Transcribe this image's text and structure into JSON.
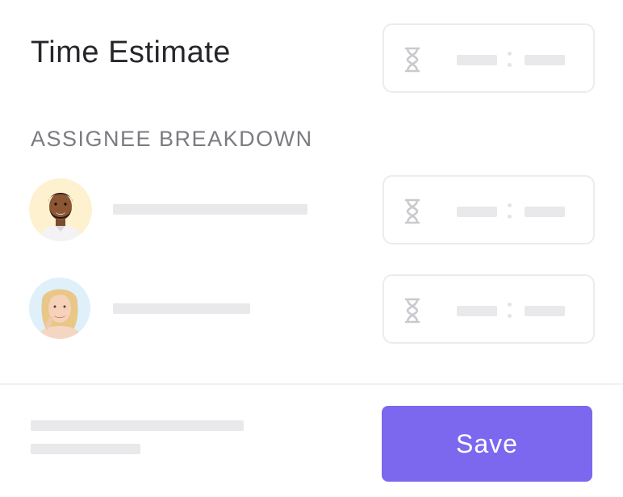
{
  "header": {
    "title": "Time Estimate"
  },
  "breakdown": {
    "section_label": "ASSIGNEE BREAKDOWN",
    "assignees": [
      {
        "avatar": "man-avatar",
        "avatar_bg": "#fdf1cf"
      },
      {
        "avatar": "woman-avatar",
        "avatar_bg": "#dff0fb"
      }
    ]
  },
  "icons": {
    "time_icon": "hourglass-icon"
  },
  "footer": {
    "save_label": "Save"
  },
  "colors": {
    "accent": "#7b68ee",
    "placeholder": "#e9e9ec",
    "border": "#ececef",
    "heading": "#26262b",
    "muted": "#7b7b80"
  }
}
